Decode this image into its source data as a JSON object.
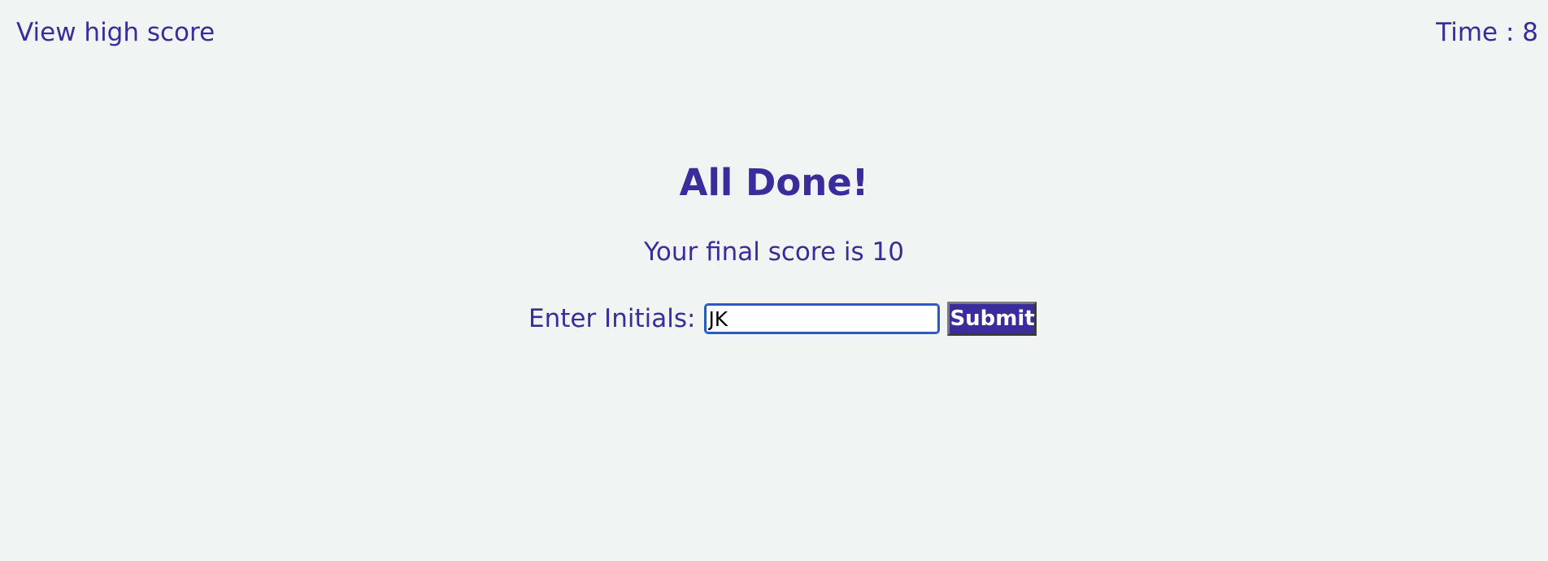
{
  "header": {
    "view_highscore_label": "View high score",
    "time_label": "Time : ",
    "time_value": "8"
  },
  "main": {
    "title": "All Done!",
    "final_score_label": "Your final score is ",
    "final_score_value": "10",
    "initials_label": "Enter Initials:",
    "initials_value": "JK",
    "submit_label": "Submit"
  },
  "colors": {
    "background": "#f0f4f3",
    "text": "#3a2c9a",
    "button_bg": "#3a2c9a",
    "button_text": "#ffffff",
    "input_border": "#2a5cbf"
  }
}
